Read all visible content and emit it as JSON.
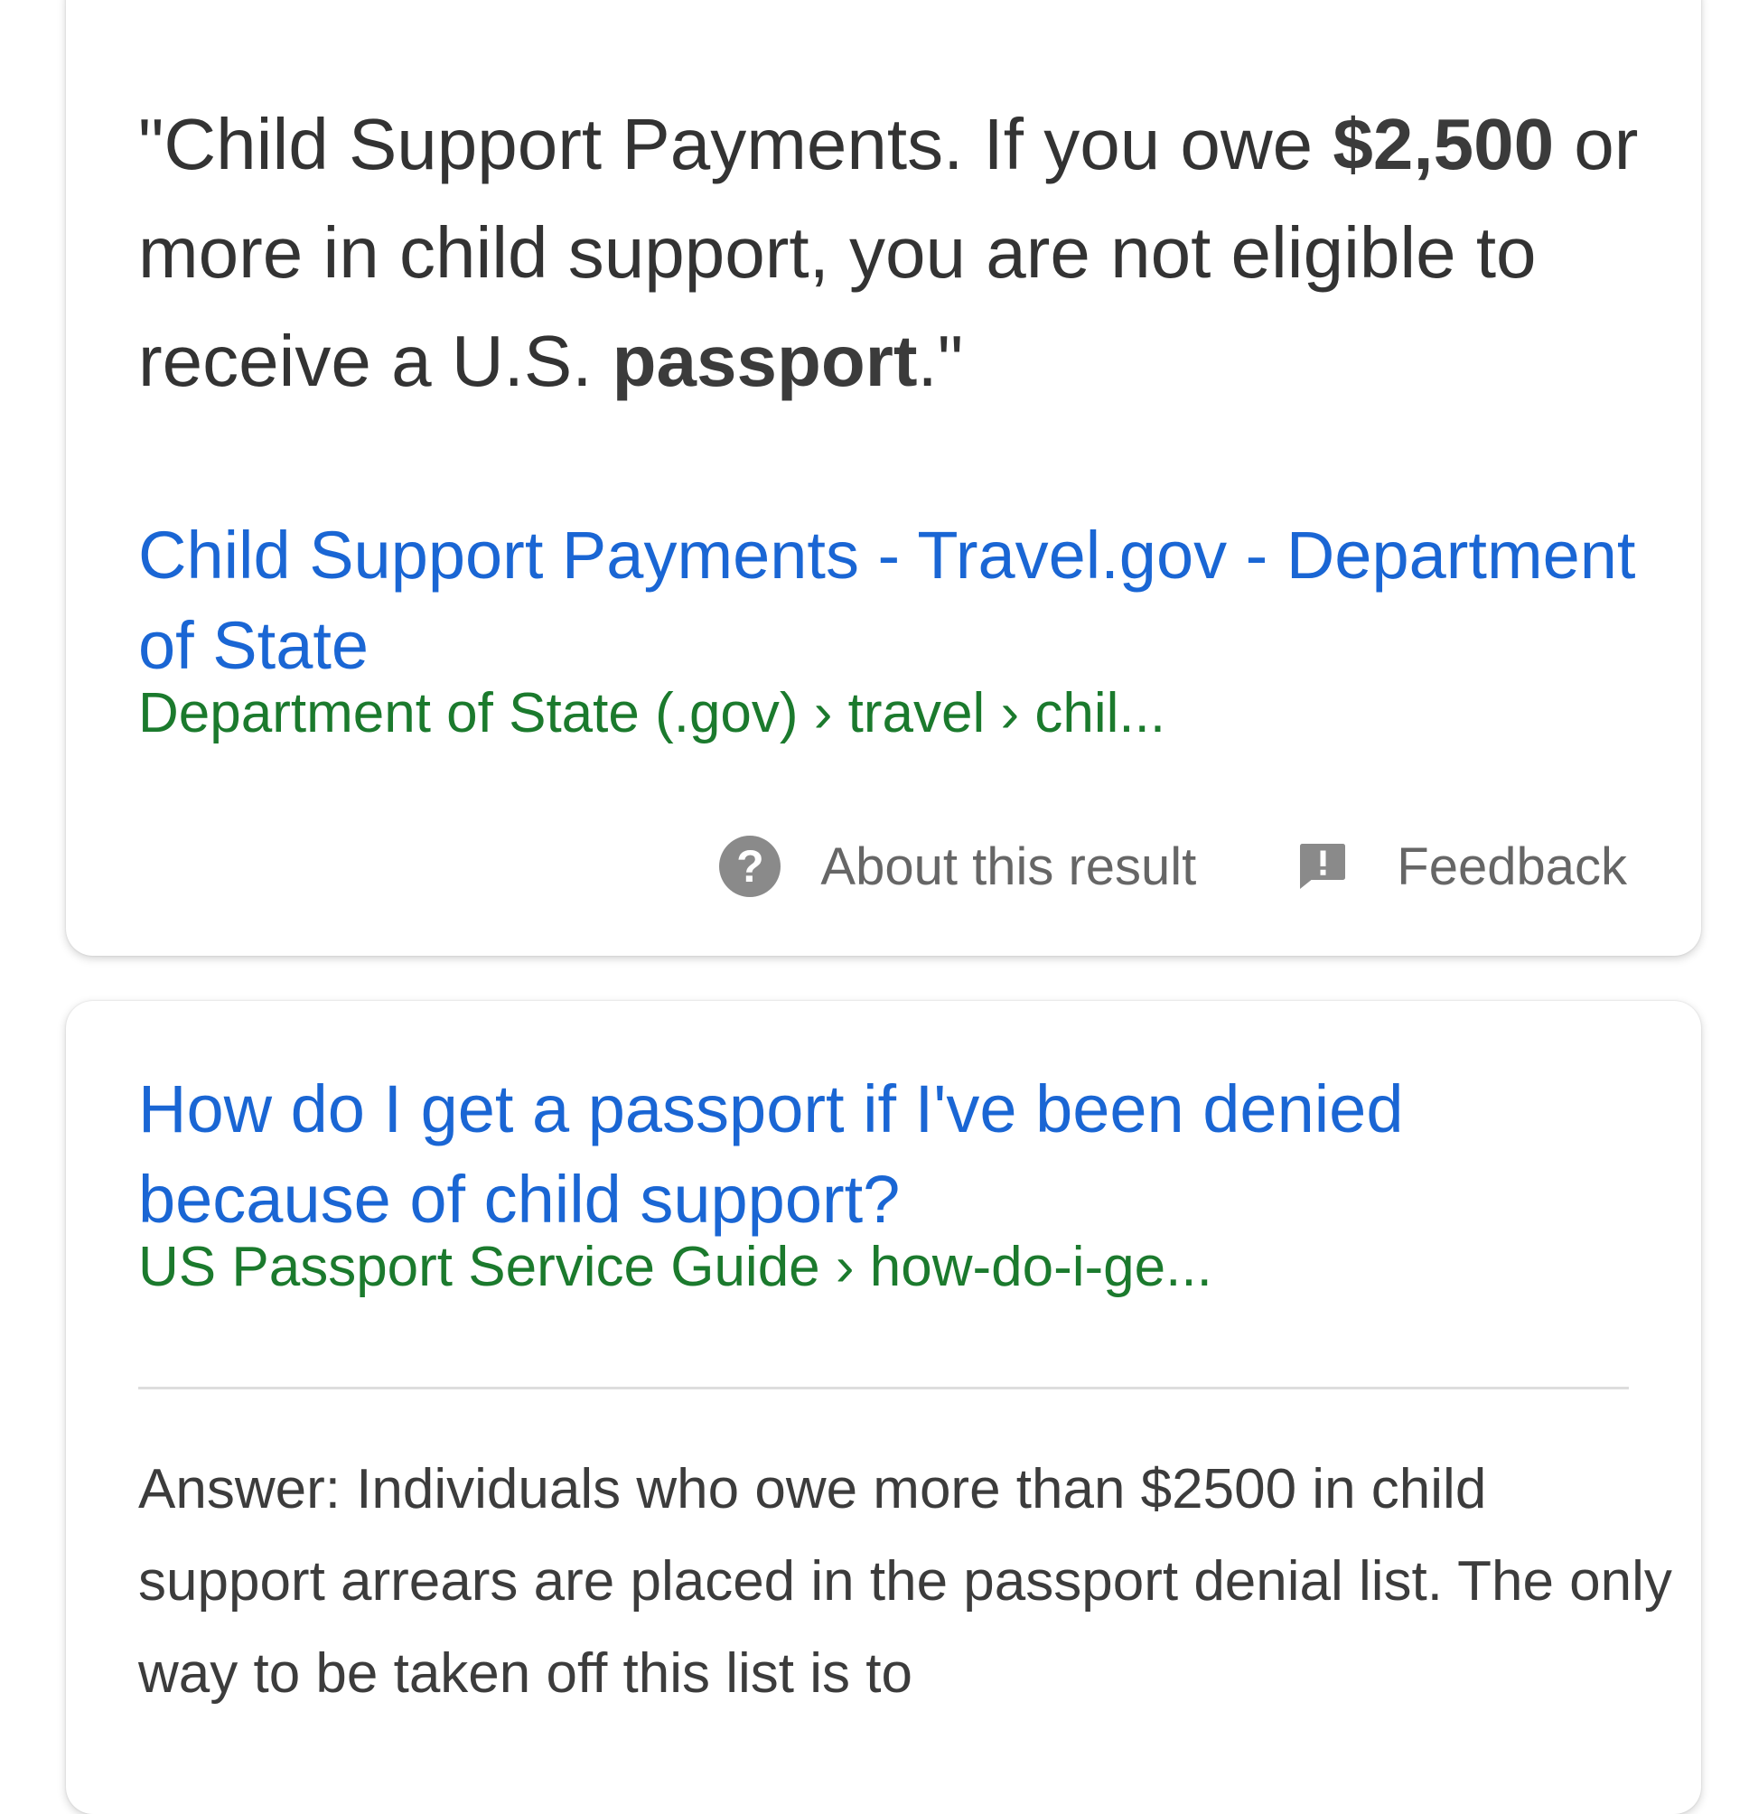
{
  "featured_snippet": {
    "quote_open": "\"",
    "part1": "Child Support Payments. If you owe ",
    "amount": "$2,500",
    "part2": " or more in child support, you are not eligible to receive a U.S. ",
    "keyword": "passport",
    "part3": ".",
    "quote_close": "\"",
    "title": "Child Support Payments - Travel.gov - Department of State",
    "breadcrumb": "Department of State (.gov) › travel › chil...",
    "about_label": "About this result",
    "feedback_label": "Feedback"
  },
  "result": {
    "title": "How do I get a passport if I've been denied because of child support?",
    "breadcrumb": "US Passport Service Guide › how-do-i-ge...",
    "answer": "Answer: Individuals who owe more than $2500 in child support arrears are placed in the passport denial list. The only way to be taken off this list is to"
  },
  "icons": {
    "about": "help-circle-icon",
    "feedback": "feedback-icon"
  },
  "colors": {
    "link": "#1a66d4",
    "url": "#1b7a2d",
    "text": "#333333",
    "muted": "#666666"
  }
}
